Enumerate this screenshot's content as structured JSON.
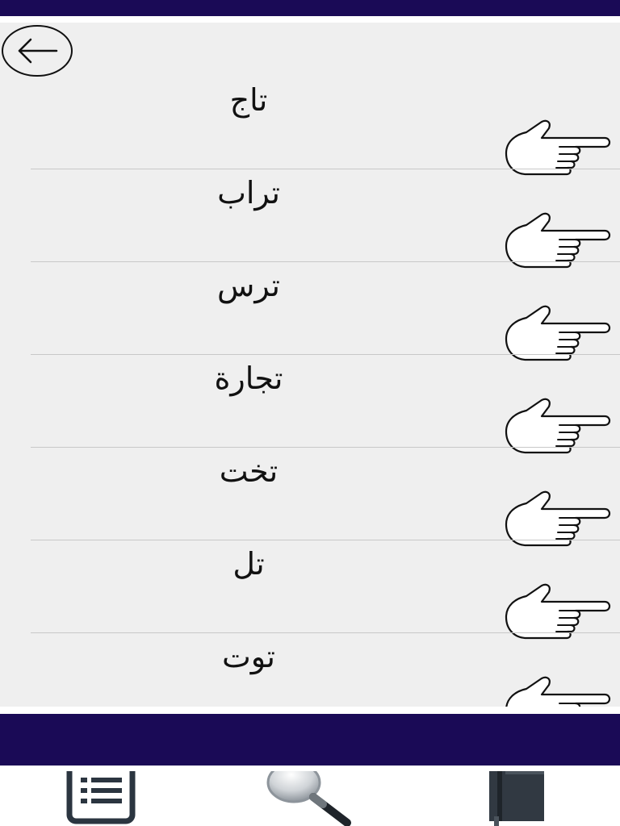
{
  "icons": {
    "back": "arrow-left-icon",
    "row": "pointing-hand-icon",
    "tab_list": "list-icon",
    "tab_search": "magnifier-icon",
    "tab_book": "book-icon"
  },
  "colors": {
    "bar": "#1a0a56",
    "content_background": "#efefef",
    "divider": "#c8c8c8",
    "text": "#111111"
  },
  "words": [
    {
      "text": "تاج"
    },
    {
      "text": "تراب"
    },
    {
      "text": "ترس"
    },
    {
      "text": "تجارة"
    },
    {
      "text": "تخت"
    },
    {
      "text": "تل"
    },
    {
      "text": "توت"
    }
  ]
}
